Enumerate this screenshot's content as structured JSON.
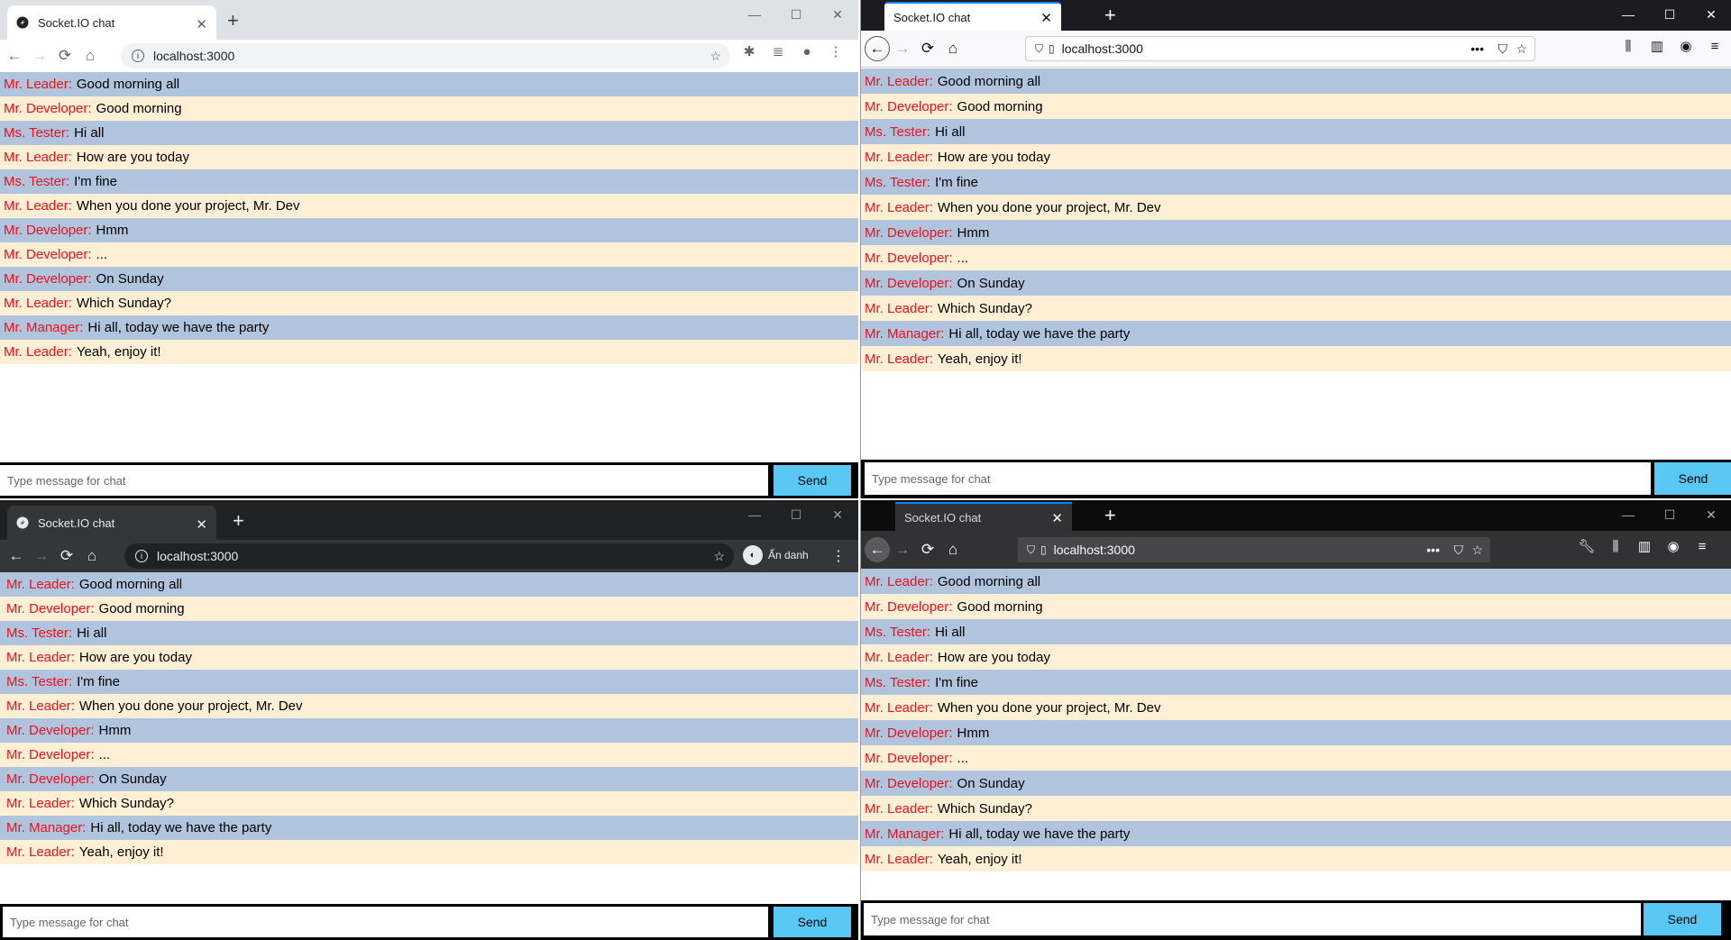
{
  "colors": {
    "row_odd": "#b0c4de",
    "row_even": "#ffefd5",
    "username": "#e8131e",
    "send_button": "#5ac8f5",
    "chrome_light_bg": "#dee1e6",
    "chrome_dark_bg": "#202124",
    "firefox_light_bg": "#1c1b22",
    "firefox_dark_bg": "#0c0c0d"
  },
  "tab_title": "Socket.IO chat",
  "url": "localhost:3000",
  "incognito_label": "Ẩn danh",
  "input_placeholder": "Type message for chat",
  "send_label": "Send",
  "messages": [
    {
      "user": "Mr. Leader:",
      "text": "Good morning all"
    },
    {
      "user": "Mr. Developer:",
      "text": "Good morning"
    },
    {
      "user": "Ms. Tester:",
      "text": "Hi all"
    },
    {
      "user": "Mr. Leader:",
      "text": "How are you today"
    },
    {
      "user": "Ms. Tester:",
      "text": "I'm fine"
    },
    {
      "user": "Mr. Leader:",
      "text": "When you done your project, Mr. Dev"
    },
    {
      "user": "Mr. Developer:",
      "text": "Hmm"
    },
    {
      "user": "Mr. Developer:",
      "text": "..."
    },
    {
      "user": "Mr. Developer:",
      "text": "On Sunday"
    },
    {
      "user": "Mr. Leader:",
      "text": "Which Sunday?"
    },
    {
      "user": "Mr. Manager:",
      "text": "Hi all, today we have the party"
    },
    {
      "user": "Mr. Leader:",
      "text": "Yeah, enjoy it!"
    }
  ],
  "windows": [
    {
      "id": "chrome-normal",
      "browser": "Chrome",
      "theme": "light"
    },
    {
      "id": "firefox-normal",
      "browser": "Firefox",
      "theme": "light"
    },
    {
      "id": "chrome-incognito",
      "browser": "Chrome",
      "theme": "dark"
    },
    {
      "id": "firefox-dark",
      "browser": "Firefox",
      "theme": "dark"
    }
  ]
}
